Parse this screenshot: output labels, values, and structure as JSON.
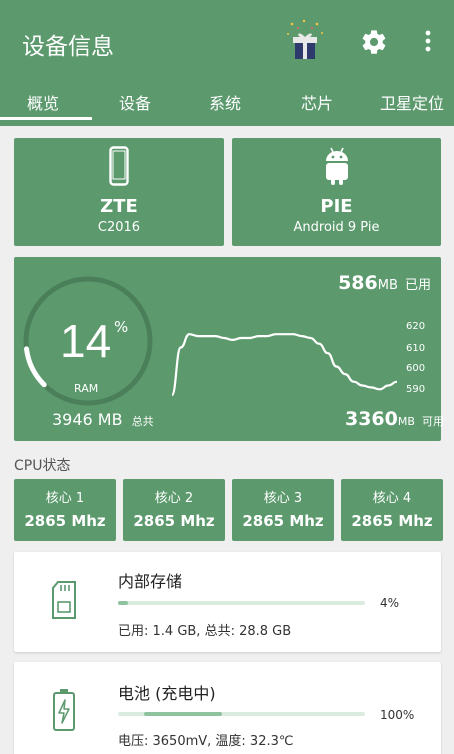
{
  "app": {
    "title": "设备信息"
  },
  "tabs": [
    {
      "label": "概览"
    },
    {
      "label": "设备"
    },
    {
      "label": "系统"
    },
    {
      "label": "芯片"
    },
    {
      "label": "卫星定位"
    }
  ],
  "device_card": {
    "brand": "ZTE",
    "model": "C2016",
    "icon": "phone-icon"
  },
  "os_card": {
    "name": "PIE",
    "version": "Android 9 Pie",
    "icon": "android-icon"
  },
  "ram": {
    "percent": "14",
    "percent_symbol": "%",
    "label": "RAM",
    "percent_value": 14,
    "used_value": "586",
    "used_unit": "MB",
    "used_label": "已用",
    "total_text": "3946 MB",
    "total_label": "总共",
    "available_value": "3360",
    "available_unit": "MB",
    "available_label": "可用"
  },
  "chart_data": {
    "type": "line",
    "y_ticks": [
      "620",
      "610",
      "600",
      "590"
    ],
    "ylim": [
      585,
      625
    ],
    "values": [
      585,
      610,
      617,
      616,
      616,
      616,
      615,
      614,
      615,
      615,
      616,
      616,
      617,
      617,
      617,
      616,
      615,
      612,
      607,
      600,
      596,
      592,
      590,
      589,
      588,
      590,
      592
    ]
  },
  "cpu": {
    "label": "CPU状态",
    "cores": [
      {
        "name": "核心 1",
        "freq": "2865 Mhz"
      },
      {
        "name": "核心 2",
        "freq": "2865 Mhz"
      },
      {
        "name": "核心 3",
        "freq": "2865 Mhz"
      },
      {
        "name": "核心 4",
        "freq": "2865 Mhz"
      }
    ]
  },
  "storage": {
    "title": "内部存储",
    "percent": "4%",
    "fill": 0.04,
    "detail": "已用: 1.4 GB,  总共: 28.8 GB",
    "icon": "sd-card-icon"
  },
  "battery": {
    "title": "电池 (充电中)",
    "percent": "100%",
    "detail": "电压: 3650mV,  温度: 32.3℃",
    "icon": "battery-charging-icon"
  },
  "colors": {
    "primary": "#5c9a6e",
    "track": "#dcebdf",
    "fill": "#8fc39f"
  }
}
